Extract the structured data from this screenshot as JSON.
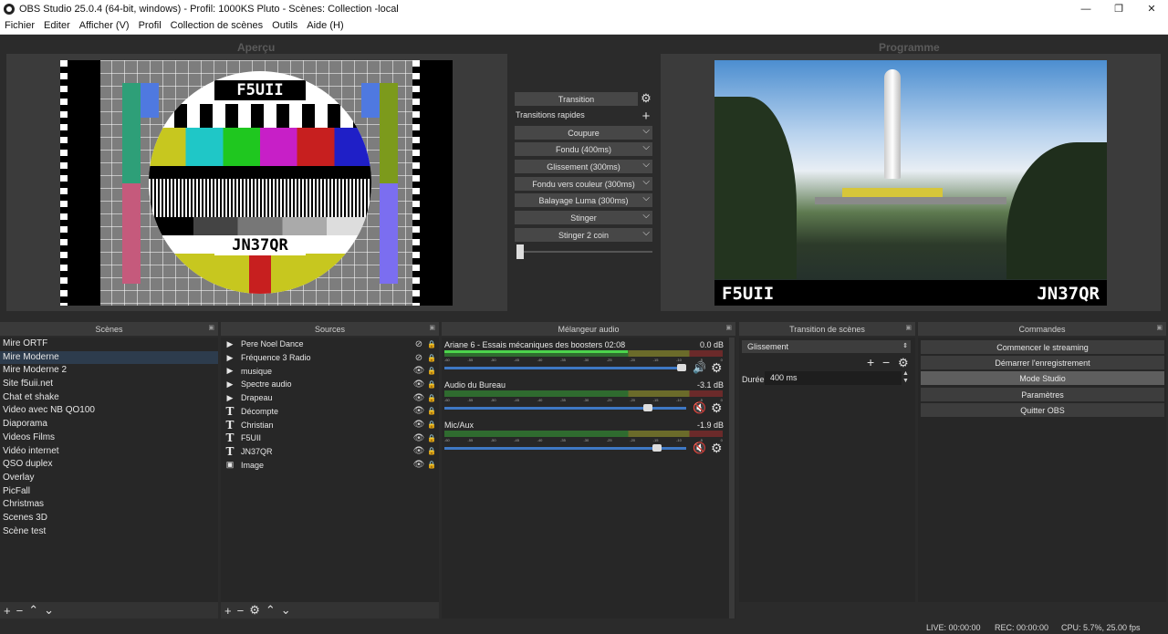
{
  "window": {
    "title": "OBS Studio 25.0.4 (64-bit, windows) - Profil: 1000KS Pluto - Scènes: Collection -local",
    "minimize": "—",
    "maximize": "❐",
    "close": "✕"
  },
  "menu": [
    "Fichier",
    "Editer",
    "Afficher (V)",
    "Profil",
    "Collection de scènes",
    "Outils",
    "Aide (H)"
  ],
  "preview": {
    "label": "Aperçu",
    "call_sign": "F5UII",
    "locator": "JN37QR"
  },
  "program": {
    "label": "Programme",
    "call_sign": "F5UII",
    "locator": "JN37QR"
  },
  "transitions": {
    "transition_button": "Transition",
    "quick_label": "Transitions rapides",
    "items": [
      "Coupure",
      "Fondu (400ms)",
      "Glissement (300ms)",
      "Fondu vers couleur (300ms)",
      "Balayage Luma (300ms)",
      "Stinger",
      "Stinger 2 coin"
    ]
  },
  "scenes": {
    "header": "Scènes",
    "selected_index": 1,
    "items": [
      "Mire ORTF",
      "Mire Moderne",
      "Mire Moderne 2",
      "Site f5uii.net",
      "Chat et shake",
      "Video avec NB QO100",
      "Diaporama",
      "Videos Films",
      "Vidéo internet",
      "QSO duplex",
      "Overlay",
      "PicFall",
      "Christmas",
      "Scenes 3D",
      "Scène test"
    ]
  },
  "sources": {
    "header": "Sources",
    "items": [
      {
        "name": "Pere Noel Dance",
        "type": "media",
        "visible": false
      },
      {
        "name": "Fréquence 3 Radio",
        "type": "media",
        "visible": false
      },
      {
        "name": "musique",
        "type": "media",
        "visible": true
      },
      {
        "name": "Spectre audio",
        "type": "media",
        "visible": true
      },
      {
        "name": "Drapeau",
        "type": "media",
        "visible": true
      },
      {
        "name": "Décompte",
        "type": "text",
        "visible": true
      },
      {
        "name": "Christian",
        "type": "text",
        "visible": true
      },
      {
        "name": "F5UII",
        "type": "text",
        "visible": true
      },
      {
        "name": "JN37QR",
        "type": "text",
        "visible": true
      },
      {
        "name": "Image",
        "type": "image",
        "visible": true
      }
    ]
  },
  "mixer": {
    "header": "Mélangeur audio",
    "ticks": [
      "-60",
      "-55",
      "-50",
      "-45",
      "-40",
      "-35",
      "-30",
      "-25",
      "-20",
      "-15",
      "-10",
      "-5",
      "0"
    ],
    "channels": [
      {
        "name": "Ariane 6 - Essais mécaniques des boosters 02:08",
        "db": "0.0 dB",
        "level": 0.66,
        "volume": 0.98,
        "muted": false
      },
      {
        "name": "Audio du Bureau",
        "db": "-3.1 dB",
        "level": 0.0,
        "volume": 0.84,
        "muted": true
      },
      {
        "name": "Mic/Aux",
        "db": "-1.9 dB",
        "level": 0.0,
        "volume": 0.88,
        "muted": true
      }
    ]
  },
  "scene_transition": {
    "header": "Transition de scènes",
    "selected": "Glissement",
    "duration_label": "Durée",
    "duration_value": "400 ms"
  },
  "controls": {
    "header": "Commandes",
    "buttons": [
      "Commencer le streaming",
      "Démarrer l'enregistrement",
      "Mode Studio",
      "Paramètres",
      "Quitter OBS"
    ],
    "active_index": 2
  },
  "status": {
    "live": "LIVE: 00:00:00",
    "rec": "REC: 00:00:00",
    "cpu": "CPU: 5.7%, 25.00 fps"
  }
}
